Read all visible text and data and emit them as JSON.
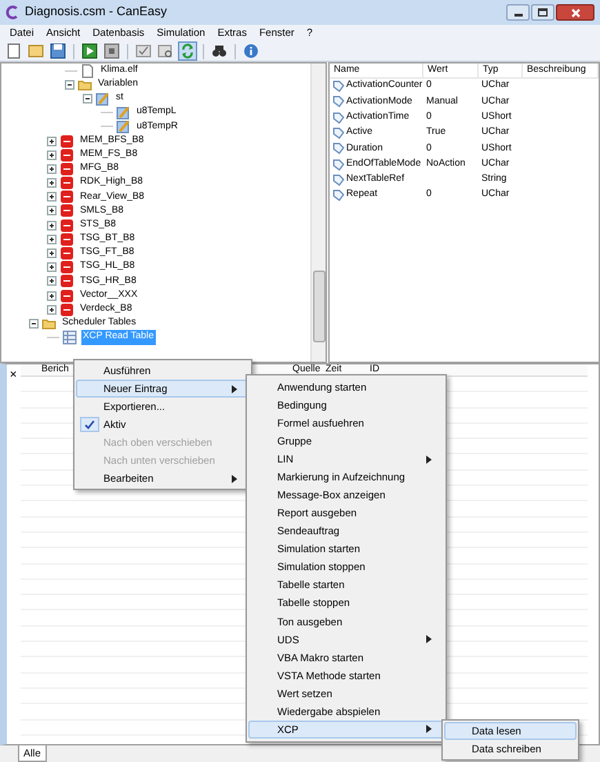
{
  "window": {
    "title": "Diagnosis.csm - CanEasy"
  },
  "menu_bar": [
    "Datei",
    "Ansicht",
    "Datenbasis",
    "Simulation",
    "Extras",
    "Fenster",
    "?"
  ],
  "toolbar": [
    {
      "kind": "new",
      "pressed": false
    },
    {
      "kind": "open",
      "pressed": false
    },
    {
      "kind": "save",
      "pressed": false
    },
    {
      "kind": "separator"
    },
    {
      "kind": "run",
      "pressed": false
    },
    {
      "kind": "stop",
      "pressed": false
    },
    {
      "kind": "separator"
    },
    {
      "kind": "check",
      "pressed": false
    },
    {
      "kind": "check-search",
      "pressed": false
    },
    {
      "kind": "refresh",
      "pressed": true
    },
    {
      "kind": "separator"
    },
    {
      "kind": "binoculars",
      "pressed": false
    },
    {
      "kind": "separator"
    },
    {
      "kind": "info",
      "pressed": false
    }
  ],
  "tree": [
    {
      "children": [
        {
          "children": [
            {
              "label": "Klima.elf",
              "kind": "file",
              "selected": false
            },
            {
              "label": "Variablen",
              "kind": "folder",
              "expanded": true,
              "selected": false,
              "children": [
                {
                  "label": "st",
                  "kind": "variable",
                  "expanded": true,
                  "selected": false,
                  "children": [
                    {
                      "label": "u8TempL",
                      "kind": "variable",
                      "selected": false
                    },
                    {
                      "label": "u8TempR",
                      "kind": "variable",
                      "selected": false
                    }
                  ]
                }
              ]
            }
          ]
        },
        {
          "label": "MEM_BFS_B8",
          "kind": "ecu",
          "expanded": false,
          "selected": false
        },
        {
          "label": "MEM_FS_B8",
          "kind": "ecu",
          "expanded": false,
          "selected": false
        },
        {
          "label": "MFG_B8",
          "kind": "ecu",
          "expanded": false,
          "selected": false
        },
        {
          "label": "RDK_High_B8",
          "kind": "ecu",
          "expanded": false,
          "selected": false
        },
        {
          "label": "Rear_View_B8",
          "kind": "ecu",
          "expanded": false,
          "selected": false
        },
        {
          "label": "SMLS_B8",
          "kind": "ecu",
          "expanded": false,
          "selected": false
        },
        {
          "label": "STS_B8",
          "kind": "ecu",
          "expanded": false,
          "selected": false
        },
        {
          "label": "TSG_BT_B8",
          "kind": "ecu",
          "expanded": false,
          "selected": false
        },
        {
          "label": "TSG_FT_B8",
          "kind": "ecu",
          "expanded": false,
          "selected": false
        },
        {
          "label": "TSG_HL_B8",
          "kind": "ecu",
          "expanded": false,
          "selected": false
        },
        {
          "label": "TSG_HR_B8",
          "kind": "ecu",
          "expanded": false,
          "selected": false
        },
        {
          "label": "Vector__XXX",
          "kind": "ecu",
          "expanded": false,
          "selected": false
        },
        {
          "label": "Verdeck_B8",
          "kind": "ecu",
          "expanded": false,
          "selected": false
        }
      ]
    },
    {
      "label": "Scheduler Tables",
      "kind": "folder",
      "expanded": true,
      "selected": false,
      "children": [
        {
          "label": "XCP Read Table",
          "kind": "table",
          "selected": true
        }
      ]
    }
  ],
  "properties": {
    "columns": [
      "Name",
      "Wert",
      "Typ",
      "Beschreibung"
    ],
    "rows": [
      [
        "ActivationCounter",
        "0",
        "UChar"
      ],
      [
        "ActivationMode",
        "Manual",
        "UChar"
      ],
      [
        "ActivationTime",
        "0",
        "UShort"
      ],
      [
        "Active",
        "True",
        "UChar"
      ],
      [
        "Duration",
        "0",
        "UShort"
      ],
      [
        "EndOfTableMode",
        "NoAction",
        "UChar"
      ],
      [
        "NextTableRef",
        "",
        "String"
      ],
      [
        "Repeat",
        "0",
        "UChar"
      ]
    ]
  },
  "log": {
    "close": "×",
    "columns": [
      "Berich",
      "Quelle",
      "Zeit",
      "ID"
    ],
    "tabs": [
      {
        "label": "Alle",
        "selected": true
      }
    ]
  },
  "context_menu": [
    {
      "label": "Ausführen",
      "selected": false,
      "checked": false,
      "disabled": false,
      "submenu": false
    },
    {
      "label": "Neuer Eintrag",
      "selected": true,
      "checked": false,
      "disabled": false,
      "submenu": true
    },
    {
      "label": "Exportieren...",
      "selected": false,
      "checked": false,
      "disabled": false,
      "submenu": false
    },
    {
      "label": "Aktiv",
      "selected": false,
      "checked": true,
      "disabled": false,
      "submenu": false
    },
    {
      "label": "Nach oben verschieben",
      "selected": false,
      "checked": false,
      "disabled": true,
      "submenu": false
    },
    {
      "label": "Nach unten verschieben",
      "selected": false,
      "checked": false,
      "disabled": true,
      "submenu": false
    },
    {
      "label": "Bearbeiten",
      "selected": false,
      "checked": false,
      "disabled": false,
      "submenu": true
    }
  ],
  "submenu": [
    {
      "label": "Anwendung starten",
      "selected": false,
      "submenu": false
    },
    {
      "label": "Bedingung",
      "selected": false,
      "submenu": false
    },
    {
      "label": "Formel ausfuehren",
      "selected": false,
      "submenu": false
    },
    {
      "label": "Gruppe",
      "selected": false,
      "submenu": false
    },
    {
      "label": "LIN",
      "selected": false,
      "submenu": true
    },
    {
      "label": "Markierung in Aufzeichnung",
      "selected": false,
      "submenu": false
    },
    {
      "label": "Message-Box anzeigen",
      "selected": false,
      "submenu": false
    },
    {
      "label": "Report ausgeben",
      "selected": false,
      "submenu": false
    },
    {
      "label": "Sendeauftrag",
      "selected": false,
      "submenu": false
    },
    {
      "label": "Simulation starten",
      "selected": false,
      "submenu": false
    },
    {
      "label": "Simulation stoppen",
      "selected": false,
      "submenu": false
    },
    {
      "label": "Tabelle starten",
      "selected": false,
      "submenu": false
    },
    {
      "label": "Tabelle stoppen",
      "selected": false,
      "submenu": false
    },
    {
      "label": "Ton ausgeben",
      "selected": false,
      "submenu": false
    },
    {
      "label": "UDS",
      "selected": false,
      "submenu": true
    },
    {
      "label": "VBA Makro starten",
      "selected": false,
      "submenu": false
    },
    {
      "label": "VSTA Methode starten",
      "selected": false,
      "submenu": false
    },
    {
      "label": "Wert setzen",
      "selected": false,
      "submenu": false
    },
    {
      "label": "Wiedergabe abspielen",
      "selected": false,
      "submenu": false
    },
    {
      "label": "XCP",
      "selected": true,
      "submenu": true
    }
  ],
  "xcp_menu": [
    {
      "label": "Data lesen",
      "selected": true
    },
    {
      "label": "Data schreiben",
      "selected": false
    }
  ]
}
